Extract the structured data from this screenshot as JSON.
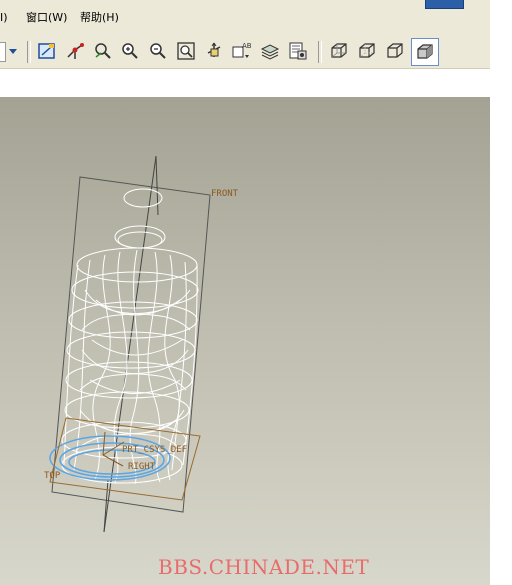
{
  "menubar": {
    "items": [
      {
        "label": "Ⅰ)"
      },
      {
        "label": "窗口(W)"
      },
      {
        "label": "帮助(H)"
      }
    ]
  },
  "toolbar": {
    "icons": [
      "dropdown-arrow-icon",
      "sketch-view-icon",
      "datum-point-icon",
      "refit-icon",
      "zoom-in-icon",
      "zoom-out-icon",
      "zoom-fit-icon",
      "reorient-icon",
      "saved-views-icon",
      "layers-icon",
      "model-tree-icon",
      "wireframe-icon",
      "hidden-line-icon",
      "no-hidden-icon",
      "shading-icon"
    ]
  },
  "viewport": {
    "datum_labels": {
      "front": "FRONT",
      "top": "TOP",
      "right": "RIGHT",
      "csys": "PRT_CSYS_DEF"
    },
    "colors": {
      "wire": "#ffffff",
      "datum": "#9a6a2e",
      "selected": "#5aa6e6",
      "frame": "#555555"
    }
  },
  "watermark": "BBS.CHINADE.NET"
}
